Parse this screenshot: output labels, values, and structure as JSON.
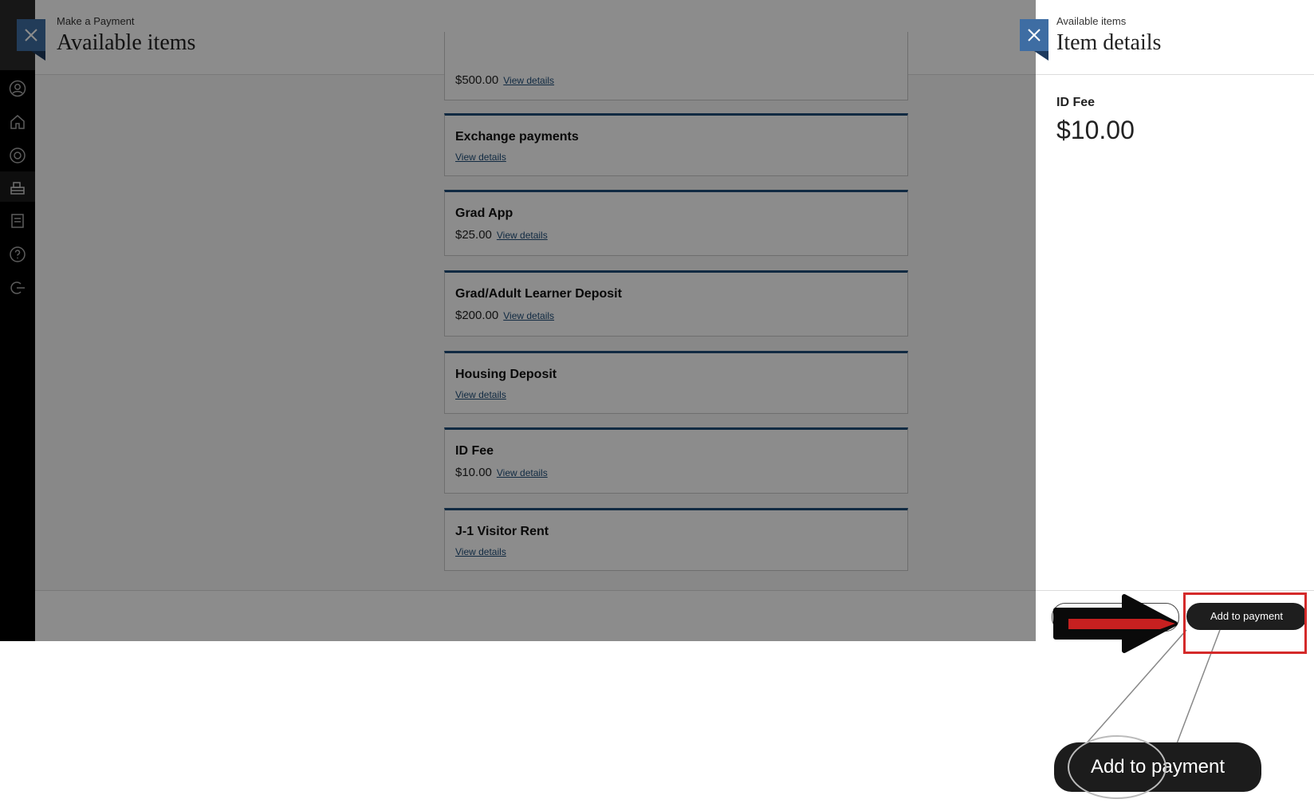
{
  "main": {
    "supertitle": "Make a Payment",
    "title": "Available items",
    "items": [
      {
        "name": "",
        "price": "$500.00",
        "link": "View details"
      },
      {
        "name": "Exchange payments",
        "price": "",
        "link": "View details"
      },
      {
        "name": "Grad App",
        "price": "$25.00",
        "link": "View details"
      },
      {
        "name": "Grad/Adult Learner Deposit",
        "price": "$200.00",
        "link": "View details"
      },
      {
        "name": "Housing Deposit",
        "price": "",
        "link": "View details"
      },
      {
        "name": "ID Fee",
        "price": "$10.00",
        "link": "View details"
      },
      {
        "name": "J-1 Visitor Rent",
        "price": "",
        "link": "View details"
      }
    ]
  },
  "panel": {
    "supertitle": "Available items",
    "title": "Item details",
    "item_name": "ID Fee",
    "item_price": "$10.00",
    "add_label": "Add to payment"
  },
  "callout": {
    "zoom_label": "Add to payment"
  },
  "nav_icons": [
    "profile-icon",
    "home-icon",
    "help-lifebuoy-icon",
    "cashier-icon",
    "statement-icon",
    "question-icon",
    "sign-out-icon"
  ],
  "colors": {
    "accent": "#3e6da3",
    "card_border_top": "#1f4e79",
    "highlight": "#d42a2a",
    "arrow": "#d42a2a"
  }
}
